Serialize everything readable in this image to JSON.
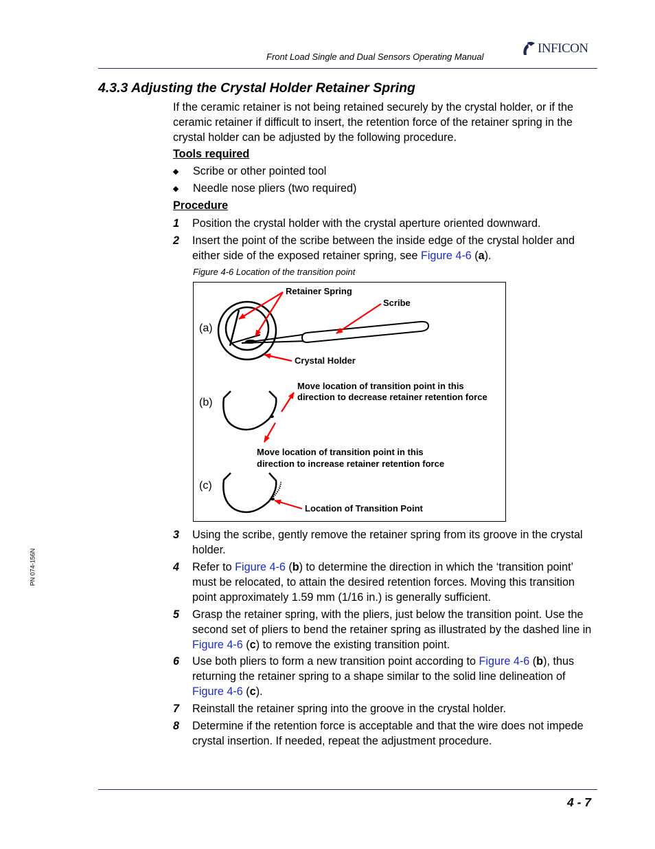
{
  "header": {
    "manual_title": "Front Load Single and Dual Sensors Operating Manual",
    "logo_text": "INFICON",
    "logo_icon": "inficon-logo-icon"
  },
  "section": {
    "title": "4.3.3  Adjusting the Crystal Holder Retainer Spring",
    "intro_lines": [
      "If the ceramic retainer is not being retained securely by the crystal holder, or if the",
      "ceramic retainer if difficult to insert, the retention force of the retainer spring in the",
      "crystal holder can be adjusted by the following procedure."
    ]
  },
  "tools": {
    "heading": "Tools required",
    "items": [
      "Scribe or other pointed tool",
      "Needle nose pliers (two required)"
    ]
  },
  "procedure": {
    "heading": "Procedure",
    "steps": [
      {
        "num": "1",
        "text": "Position the crystal holder with the crystal aperture oriented downward."
      },
      {
        "num": "2",
        "pre": "Insert the point of the scribe between the inside edge of the crystal holder and either side of the exposed retainer spring, see ",
        "link": "Figure 4-6",
        "mid": " (",
        "bold": "a",
        "post": ")."
      },
      {
        "num": "3",
        "text": "Using the scribe, gently remove the retainer spring from its groove in the crystal holder."
      },
      {
        "num": "4",
        "pre": "Refer to ",
        "link": "Figure 4-6",
        "mid": " (",
        "bold": "b",
        "post": ") to determine the direction in which the ‘transition point’ must be relocated, to attain the desired retention forces. Moving this transition point approximately 1.59 mm (1/16 in.) is generally sufficient."
      },
      {
        "num": "5",
        "pre": "Grasp the retainer spring, with the pliers, just below the transition point. Use the second set of pliers to bend the retainer spring as illustrated by the dashed line in ",
        "link": "Figure 4-6",
        "mid": " (",
        "bold": "c",
        "post": ") to remove the existing transition point."
      },
      {
        "num": "6",
        "pre": "Use both pliers to form a new transition point according to ",
        "link": "Figure 4-6",
        "mid": " (",
        "bold": "b",
        "post": "), thus returning the retainer spring to a shape similar to the solid line delineation of ",
        "link2": "Figure 4-6",
        "mid2": " (",
        "bold2": "c",
        "post2": ")."
      },
      {
        "num": "7",
        "text": "Reinstall the retainer spring into the groove in the crystal holder."
      },
      {
        "num": "8",
        "text": "Determine if the retention force is acceptable and that the wire does not impede crystal insertion. If needed, repeat the adjustment procedure."
      }
    ]
  },
  "figure": {
    "caption": "Figure 4-6  Location of the transition point",
    "panel_labels": [
      "(a)",
      "(b)",
      "(c)"
    ],
    "labels": {
      "retainer_spring": "Retainer Spring",
      "scribe": "Scribe",
      "crystal_holder": "Crystal Holder",
      "decrease_line1": "Move location of transition point in this",
      "decrease_line2": "direction to decrease retainer retention force",
      "increase_line1": "Move location of transition point in this",
      "increase_line2": "direction to increase retainer retention force",
      "transition_point": "Location of Transition Point"
    },
    "arrow_color": "#ff0000"
  },
  "footer": {
    "part_number": "PN 074-156N",
    "page_number": "4 - 7"
  }
}
